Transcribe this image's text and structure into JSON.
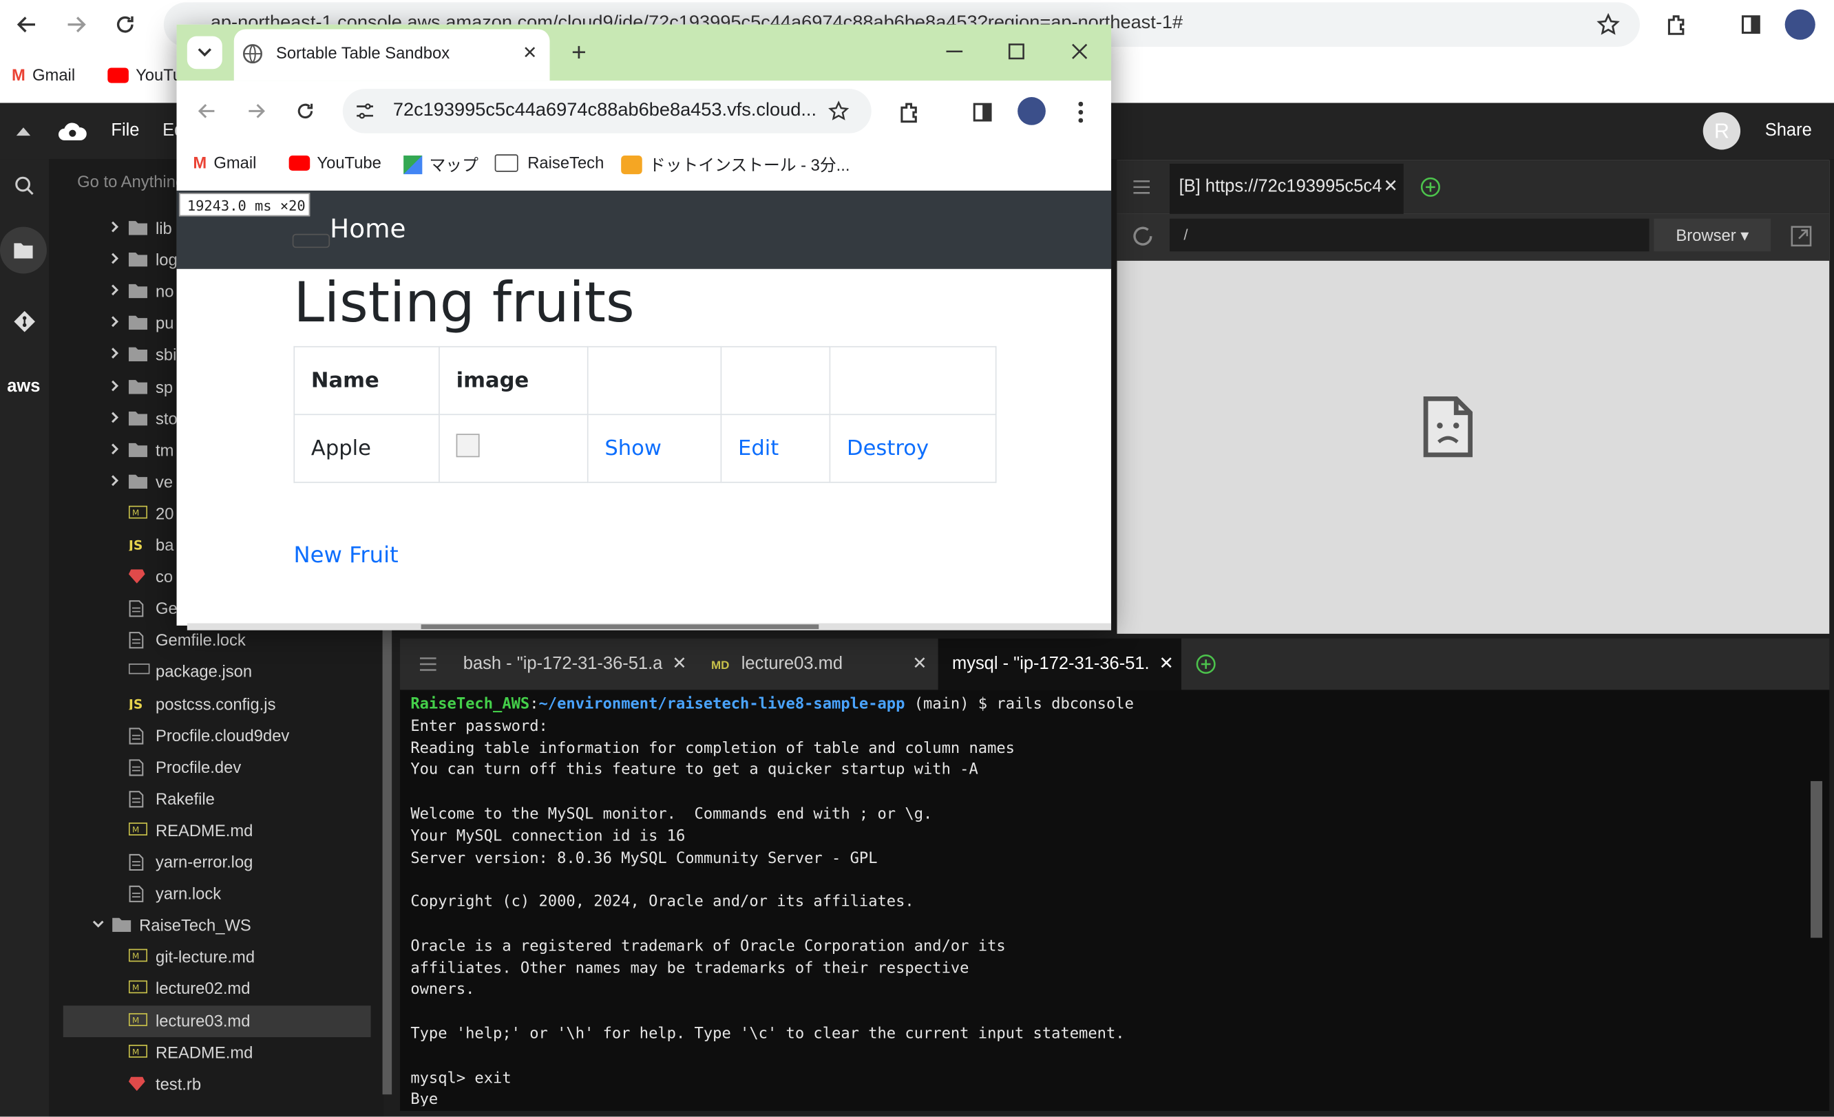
{
  "outer_browser": {
    "url": "ap-northeast-1.console.aws.amazon.com/cloud9/ide/72c193995c5c44a6974c88ab6be8a453?region=ap-northeast-1#",
    "bookmarks": [
      "Gmail",
      "YouTu"
    ]
  },
  "ide": {
    "menu": [
      "File",
      "Ed"
    ],
    "share_label": "Share",
    "avatar_letter": "R",
    "goto_placeholder": "Go to Anything",
    "tree": [
      {
        "name": "lib",
        "kind": "folder",
        "indent": 1
      },
      {
        "name": "log",
        "kind": "folder",
        "indent": 1
      },
      {
        "name": "no",
        "kind": "folder",
        "indent": 1
      },
      {
        "name": "pu",
        "kind": "folder",
        "indent": 1
      },
      {
        "name": "sbi",
        "kind": "folder",
        "indent": 1
      },
      {
        "name": "sp",
        "kind": "folder",
        "indent": 1
      },
      {
        "name": "sto",
        "kind": "folder",
        "indent": 1
      },
      {
        "name": "tm",
        "kind": "folder",
        "indent": 1
      },
      {
        "name": "ve",
        "kind": "folder",
        "indent": 1
      },
      {
        "name": "20",
        "kind": "md",
        "indent": 1
      },
      {
        "name": "ba",
        "kind": "js",
        "indent": 1
      },
      {
        "name": "co",
        "kind": "rb",
        "indent": 1
      },
      {
        "name": "Ge",
        "kind": "file",
        "indent": 1
      },
      {
        "name": "Gemfile.lock",
        "kind": "file",
        "indent": 1
      },
      {
        "name": "package.json",
        "kind": "json",
        "indent": 1
      },
      {
        "name": "postcss.config.js",
        "kind": "js",
        "indent": 1
      },
      {
        "name": "Procfile.cloud9dev",
        "kind": "file",
        "indent": 1
      },
      {
        "name": "Procfile.dev",
        "kind": "file",
        "indent": 1
      },
      {
        "name": "Rakefile",
        "kind": "file",
        "indent": 1
      },
      {
        "name": "README.md",
        "kind": "md",
        "indent": 1
      },
      {
        "name": "yarn-error.log",
        "kind": "file",
        "indent": 1
      },
      {
        "name": "yarn.lock",
        "kind": "file",
        "indent": 1
      },
      {
        "name": "RaiseTech_WS",
        "kind": "folder-open",
        "indent": 0
      },
      {
        "name": "git-lecture.md",
        "kind": "md",
        "indent": 1
      },
      {
        "name": "lecture02.md",
        "kind": "md",
        "indent": 1
      },
      {
        "name": "lecture03.md",
        "kind": "md",
        "indent": 1,
        "selected": true
      },
      {
        "name": "README.md",
        "kind": "md",
        "indent": 1
      },
      {
        "name": "test.rb",
        "kind": "rb",
        "indent": 1
      }
    ],
    "preview": {
      "tab_label": "[B] https://72c193995c5c4",
      "path": "/",
      "browser_label": "Browser"
    },
    "terminal_tabs": [
      {
        "label": "bash - \"ip-172-31-36-51.a",
        "active": false
      },
      {
        "label": "lecture03.md",
        "active": false
      },
      {
        "label": "mysql - \"ip-172-31-36-51.",
        "active": true
      }
    ],
    "terminal": {
      "prompt_user": "RaiseTech_AWS",
      "prompt_path": "~/environment/raisetech-live8-sample-app",
      "prompt_cmd": " (main) $ rails dbconsole",
      "lines": [
        "Enter password:",
        "Reading table information for completion of table and column names",
        "You can turn off this feature to get a quicker startup with -A",
        "",
        "Welcome to the MySQL monitor.  Commands end with ; or \\g.",
        "Your MySQL connection id is 16",
        "Server version: 8.0.36 MySQL Community Server - GPL",
        "",
        "Copyright (c) 2000, 2024, Oracle and/or its affiliates.",
        "",
        "Oracle is a registered trademark of Oracle Corporation and/or its",
        "affiliates. Other names may be trademarks of their respective",
        "owners.",
        "",
        "Type 'help;' or '\\h' for help. Type '\\c' to clear the current input statement.",
        "",
        "mysql> exit",
        "Bye"
      ]
    }
  },
  "popup": {
    "tab_title": "Sortable Table Sandbox",
    "url": "72c193995c5c44a6974c88ab6be8a453.vfs.cloud...",
    "bookmarks": [
      "Gmail",
      "YouTube",
      "マップ",
      "RaiseTech",
      "ドットインストール - 3分..."
    ],
    "perf_badge": "19243.0 ms ×20",
    "page": {
      "nav_brand": "Home",
      "heading": "Listing fruits",
      "columns": [
        "Name",
        "image",
        "",
        "",
        ""
      ],
      "rows": [
        {
          "name": "Apple",
          "show": "Show",
          "edit": "Edit",
          "destroy": "Destroy"
        }
      ],
      "new_link": "New Fruit"
    }
  },
  "colors": {
    "popup_titlebar": "#c8e8b4",
    "link": "#0d6efd",
    "navbar": "#343a40",
    "prompt_green": "#44d04a",
    "prompt_blue": "#4aa4ff"
  }
}
